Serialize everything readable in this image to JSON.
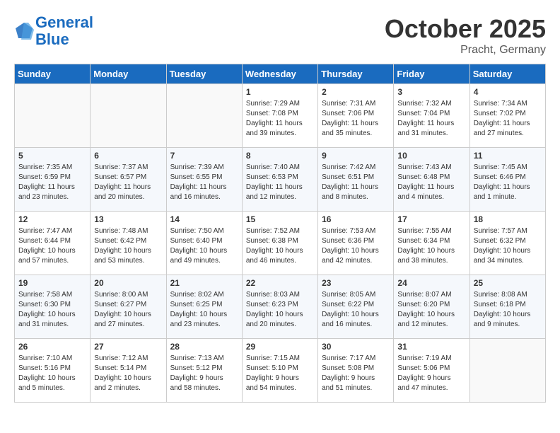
{
  "header": {
    "logo_line1": "General",
    "logo_line2": "Blue",
    "month": "October 2025",
    "location": "Pracht, Germany"
  },
  "weekdays": [
    "Sunday",
    "Monday",
    "Tuesday",
    "Wednesday",
    "Thursday",
    "Friday",
    "Saturday"
  ],
  "weeks": [
    [
      {
        "day": "",
        "info": ""
      },
      {
        "day": "",
        "info": ""
      },
      {
        "day": "",
        "info": ""
      },
      {
        "day": "1",
        "info": "Sunrise: 7:29 AM\nSunset: 7:08 PM\nDaylight: 11 hours\nand 39 minutes."
      },
      {
        "day": "2",
        "info": "Sunrise: 7:31 AM\nSunset: 7:06 PM\nDaylight: 11 hours\nand 35 minutes."
      },
      {
        "day": "3",
        "info": "Sunrise: 7:32 AM\nSunset: 7:04 PM\nDaylight: 11 hours\nand 31 minutes."
      },
      {
        "day": "4",
        "info": "Sunrise: 7:34 AM\nSunset: 7:02 PM\nDaylight: 11 hours\nand 27 minutes."
      }
    ],
    [
      {
        "day": "5",
        "info": "Sunrise: 7:35 AM\nSunset: 6:59 PM\nDaylight: 11 hours\nand 23 minutes."
      },
      {
        "day": "6",
        "info": "Sunrise: 7:37 AM\nSunset: 6:57 PM\nDaylight: 11 hours\nand 20 minutes."
      },
      {
        "day": "7",
        "info": "Sunrise: 7:39 AM\nSunset: 6:55 PM\nDaylight: 11 hours\nand 16 minutes."
      },
      {
        "day": "8",
        "info": "Sunrise: 7:40 AM\nSunset: 6:53 PM\nDaylight: 11 hours\nand 12 minutes."
      },
      {
        "day": "9",
        "info": "Sunrise: 7:42 AM\nSunset: 6:51 PM\nDaylight: 11 hours\nand 8 minutes."
      },
      {
        "day": "10",
        "info": "Sunrise: 7:43 AM\nSunset: 6:48 PM\nDaylight: 11 hours\nand 4 minutes."
      },
      {
        "day": "11",
        "info": "Sunrise: 7:45 AM\nSunset: 6:46 PM\nDaylight: 11 hours\nand 1 minute."
      }
    ],
    [
      {
        "day": "12",
        "info": "Sunrise: 7:47 AM\nSunset: 6:44 PM\nDaylight: 10 hours\nand 57 minutes."
      },
      {
        "day": "13",
        "info": "Sunrise: 7:48 AM\nSunset: 6:42 PM\nDaylight: 10 hours\nand 53 minutes."
      },
      {
        "day": "14",
        "info": "Sunrise: 7:50 AM\nSunset: 6:40 PM\nDaylight: 10 hours\nand 49 minutes."
      },
      {
        "day": "15",
        "info": "Sunrise: 7:52 AM\nSunset: 6:38 PM\nDaylight: 10 hours\nand 46 minutes."
      },
      {
        "day": "16",
        "info": "Sunrise: 7:53 AM\nSunset: 6:36 PM\nDaylight: 10 hours\nand 42 minutes."
      },
      {
        "day": "17",
        "info": "Sunrise: 7:55 AM\nSunset: 6:34 PM\nDaylight: 10 hours\nand 38 minutes."
      },
      {
        "day": "18",
        "info": "Sunrise: 7:57 AM\nSunset: 6:32 PM\nDaylight: 10 hours\nand 34 minutes."
      }
    ],
    [
      {
        "day": "19",
        "info": "Sunrise: 7:58 AM\nSunset: 6:30 PM\nDaylight: 10 hours\nand 31 minutes."
      },
      {
        "day": "20",
        "info": "Sunrise: 8:00 AM\nSunset: 6:27 PM\nDaylight: 10 hours\nand 27 minutes."
      },
      {
        "day": "21",
        "info": "Sunrise: 8:02 AM\nSunset: 6:25 PM\nDaylight: 10 hours\nand 23 minutes."
      },
      {
        "day": "22",
        "info": "Sunrise: 8:03 AM\nSunset: 6:23 PM\nDaylight: 10 hours\nand 20 minutes."
      },
      {
        "day": "23",
        "info": "Sunrise: 8:05 AM\nSunset: 6:22 PM\nDaylight: 10 hours\nand 16 minutes."
      },
      {
        "day": "24",
        "info": "Sunrise: 8:07 AM\nSunset: 6:20 PM\nDaylight: 10 hours\nand 12 minutes."
      },
      {
        "day": "25",
        "info": "Sunrise: 8:08 AM\nSunset: 6:18 PM\nDaylight: 10 hours\nand 9 minutes."
      }
    ],
    [
      {
        "day": "26",
        "info": "Sunrise: 7:10 AM\nSunset: 5:16 PM\nDaylight: 10 hours\nand 5 minutes."
      },
      {
        "day": "27",
        "info": "Sunrise: 7:12 AM\nSunset: 5:14 PM\nDaylight: 10 hours\nand 2 minutes."
      },
      {
        "day": "28",
        "info": "Sunrise: 7:13 AM\nSunset: 5:12 PM\nDaylight: 9 hours\nand 58 minutes."
      },
      {
        "day": "29",
        "info": "Sunrise: 7:15 AM\nSunset: 5:10 PM\nDaylight: 9 hours\nand 54 minutes."
      },
      {
        "day": "30",
        "info": "Sunrise: 7:17 AM\nSunset: 5:08 PM\nDaylight: 9 hours\nand 51 minutes."
      },
      {
        "day": "31",
        "info": "Sunrise: 7:19 AM\nSunset: 5:06 PM\nDaylight: 9 hours\nand 47 minutes."
      },
      {
        "day": "",
        "info": ""
      }
    ]
  ]
}
